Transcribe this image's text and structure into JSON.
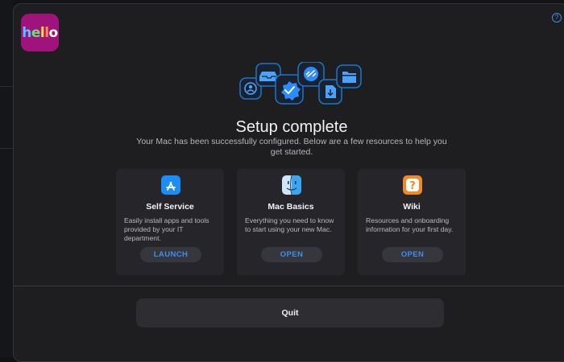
{
  "app": {
    "logo_text": "hello"
  },
  "header": {
    "help_glyph": "?"
  },
  "hero": {
    "icons": [
      "person-icon",
      "inbox-tray-icon",
      "checkmark-badge-icon",
      "link-icon",
      "download-doc-icon",
      "folder-icon"
    ]
  },
  "main": {
    "title": "Setup complete",
    "subtitle": "Your Mac has been successfully configured. Below are a few resources to help you get started."
  },
  "cards": [
    {
      "title": "Self Service",
      "description": "Easily install apps and tools provided by your IT department.",
      "button": "LAUNCH",
      "icon": "app-store-icon",
      "icon_color": "#1e8cf5"
    },
    {
      "title": "Mac Basics",
      "description": "Everything you need to know to start using your new Mac.",
      "button": "OPEN",
      "icon": "finder-icon",
      "icon_color": "#3aa6f2"
    },
    {
      "title": "Wiki",
      "description": "Resources and onboarding information for your first day.",
      "button": "OPEN",
      "icon": "question-icon",
      "icon_color": "#f08a24"
    }
  ],
  "footer": {
    "quit_label": "Quit"
  },
  "colors": {
    "accent": "#3d8ff0",
    "window_bg": "#1e1e21",
    "card_bg": "#26262a",
    "logo_bg": "#a0127c"
  }
}
